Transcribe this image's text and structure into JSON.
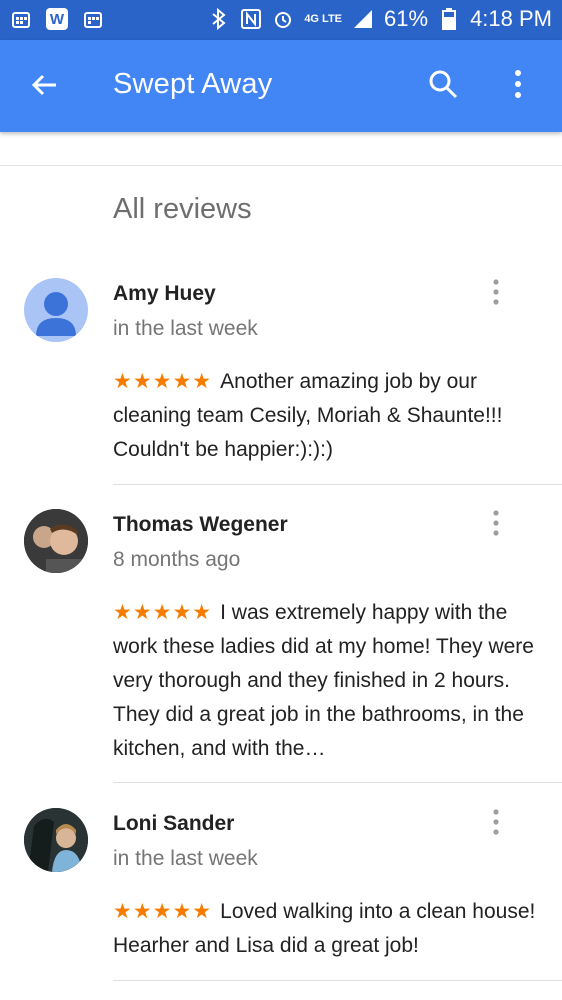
{
  "status_bar": {
    "battery": "61%",
    "time": "4:18 PM",
    "network": "4G LTE",
    "w_app_label": "W"
  },
  "app_bar": {
    "title": "Swept Away"
  },
  "section_title": "All reviews",
  "reviews": [
    {
      "name": "Amy Huey",
      "time": "in the last week",
      "stars": "★★★★★",
      "text": "Another amazing job by our cleaning team Cesily, Moriah & Shaunte!!! Couldn't be happier:):):)"
    },
    {
      "name": "Thomas Wegener",
      "time": "8 months ago",
      "stars": "★★★★★",
      "text": "I was extremely happy with the work these ladies did at my home! They were very thorough and they finished in 2 hours. They did a great job in the bathrooms, in the kitchen, and with the…"
    },
    {
      "name": "Loni Sander",
      "time": "in the last week",
      "stars": "★★★★★",
      "text": "Loved walking into a clean house! Hearher and Lisa did a great job!"
    }
  ],
  "colors": {
    "status_bar": "#2a64c8",
    "app_bar": "#4285f4",
    "star": "#f57c00"
  }
}
